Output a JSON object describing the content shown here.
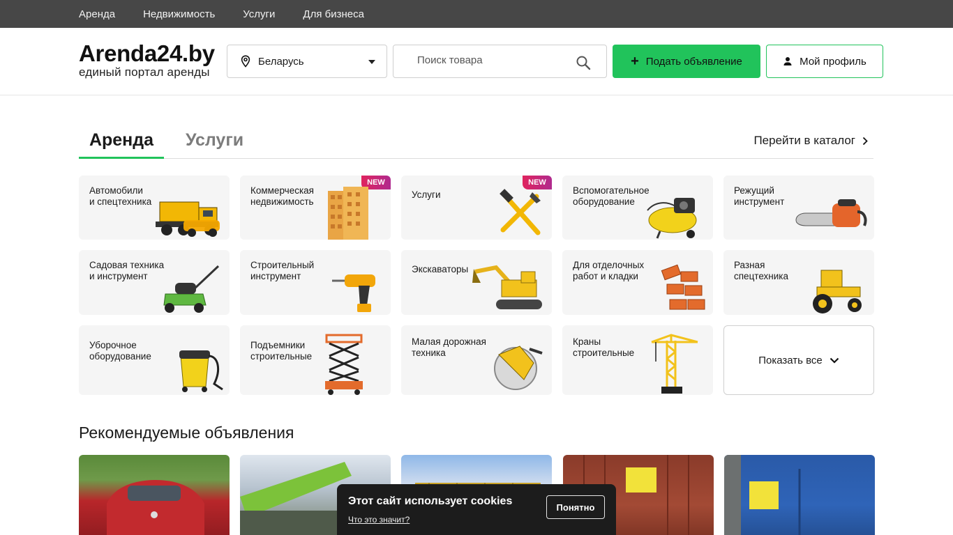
{
  "topnav": [
    "Аренда",
    "Недвижимость",
    "Услуги",
    "Для бизнеса"
  ],
  "logo": {
    "title": "Arenda24.by",
    "subtitle": "единый портал аренды"
  },
  "region": {
    "value": "Беларусь",
    "icon": "map-pin-icon"
  },
  "search": {
    "placeholder": "Поиск товара",
    "icon": "search-icon"
  },
  "post_button": {
    "label": "Подать объявление",
    "icon": "plus-icon"
  },
  "profile_button": {
    "label": "Мой профиль",
    "icon": "user-icon"
  },
  "tabs": {
    "active": "Аренда",
    "inactive": "Услуги"
  },
  "catalog_link": "Перейти в каталог",
  "categories": [
    {
      "label": "Автомобили\nи спецтехника",
      "icon": "truck-icon",
      "badge": ""
    },
    {
      "label": "Коммерческая\nнедвижимость",
      "icon": "building-icon",
      "badge": "NEW"
    },
    {
      "label": "Услуги",
      "icon": "tools-icon",
      "badge": "NEW"
    },
    {
      "label": "Вспомогательное\nоборудование",
      "icon": "compressor-icon",
      "badge": ""
    },
    {
      "label": "Режущий\nинструмент",
      "icon": "chainsaw-icon",
      "badge": ""
    },
    {
      "label": "Садовая техника\nи инструмент",
      "icon": "lawnmower-icon",
      "badge": ""
    },
    {
      "label": "Строительный\nинструмент",
      "icon": "drill-icon",
      "badge": ""
    },
    {
      "label": "Экскаваторы",
      "icon": "excavator-icon",
      "badge": ""
    },
    {
      "label": "Для отделочных\nработ и кладки",
      "icon": "bricks-icon",
      "badge": ""
    },
    {
      "label": "Разная\nспецтехника",
      "icon": "tractor-icon",
      "badge": ""
    },
    {
      "label": "Уборочное\nоборудование",
      "icon": "vacuum-icon",
      "badge": ""
    },
    {
      "label": "Подъемники\nстроительные",
      "icon": "scissor-lift-icon",
      "badge": ""
    },
    {
      "label": "Малая дорожная\nтехника",
      "icon": "road-saw-icon",
      "badge": ""
    },
    {
      "label": "Краны\nстроительные",
      "icon": "crane-icon",
      "badge": ""
    }
  ],
  "show_all": "Показать все",
  "recommended_title": "Рекомендуемые объявления",
  "recommended": [
    {
      "image": "red-car-photo",
      "color": "#b8262a"
    },
    {
      "image": "crane-truck-photo",
      "color": "#6f9a3a"
    },
    {
      "image": "yellow-container-photo",
      "color": "#c9a227"
    },
    {
      "image": "red-container-photo",
      "color": "#a34a35"
    },
    {
      "image": "blue-container-photo",
      "color": "#2f64b8"
    }
  ],
  "cookie": {
    "title": "Этот сайт использует cookies",
    "link": "Что это значит?",
    "button": "Понятно"
  },
  "colors": {
    "accent": "#21c35b",
    "topbar": "#474747",
    "card_bg": "#f5f5f5",
    "cookie_bg": "#1c1c1c"
  }
}
